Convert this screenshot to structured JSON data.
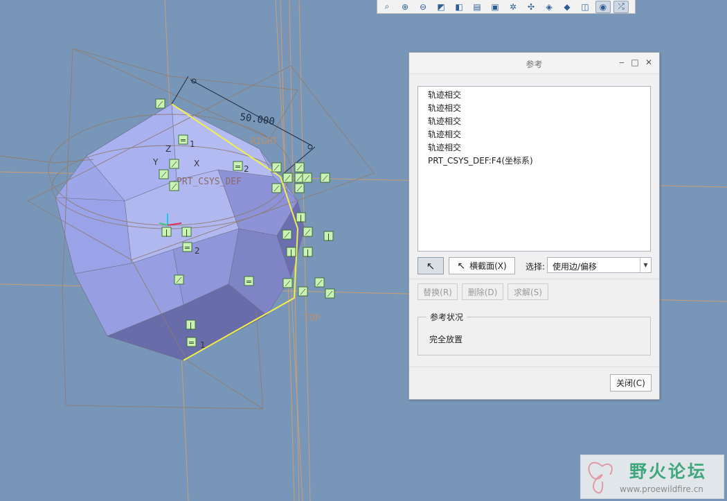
{
  "toolbar": {
    "icons": [
      {
        "name": "refit-icon",
        "glyph": "⌕"
      },
      {
        "name": "zoom-in-icon",
        "glyph": "⊕"
      },
      {
        "name": "zoom-out-icon",
        "glyph": "⊖"
      },
      {
        "name": "repaint-icon",
        "glyph": "◩"
      },
      {
        "name": "shaded-view-icon",
        "glyph": "◧"
      },
      {
        "name": "saved-views-icon",
        "glyph": "▤"
      },
      {
        "name": "view-manager-icon",
        "glyph": "▣"
      },
      {
        "name": "datum-display-icon",
        "glyph": "✲"
      },
      {
        "name": "spin-center-icon",
        "glyph": "✣"
      },
      {
        "name": "orient-icon",
        "glyph": "◈"
      },
      {
        "name": "display-style-icon",
        "glyph": "◆"
      },
      {
        "name": "annotation-display-icon",
        "glyph": "◫"
      },
      {
        "name": "show-icon",
        "glyph": "◉"
      },
      {
        "name": "sketch-references-icon",
        "glyph": "⤮"
      }
    ]
  },
  "sketch": {
    "dimension_label": "50.000",
    "csys_label": "PRT_CSYS_DEF",
    "plane_right": "RIGHT",
    "plane_top": "TOP",
    "axis_x": "X",
    "axis_y": "Y",
    "axis_z": "Z",
    "constraint_labels": {
      "c1": "1",
      "c2": "2",
      "c3": "2",
      "c4": "1"
    }
  },
  "dialog": {
    "title": "参考",
    "controls": {
      "minimize": "‒",
      "maximize": "□",
      "close": "✕"
    },
    "references": [
      "轨迹相交",
      "轨迹相交",
      "轨迹相交",
      "轨迹相交",
      "轨迹相交",
      "PRT_CSYS_DEF:F4(坐标系)"
    ],
    "pointer_glyph": "↖",
    "xsection_button": "横截面(X)",
    "select_label": "选择:",
    "select_value": "使用边/偏移",
    "select_arrow": "▼",
    "replace_button": "替换(R)",
    "delete_button": "删除(D)",
    "solve_button": "求解(S)",
    "status_group_label": "参考状况",
    "status_text": "完全放置",
    "close_button": "关闭(C)"
  },
  "watermark": {
    "title": "野火论坛",
    "url": "www.proewildfire.cn"
  }
}
